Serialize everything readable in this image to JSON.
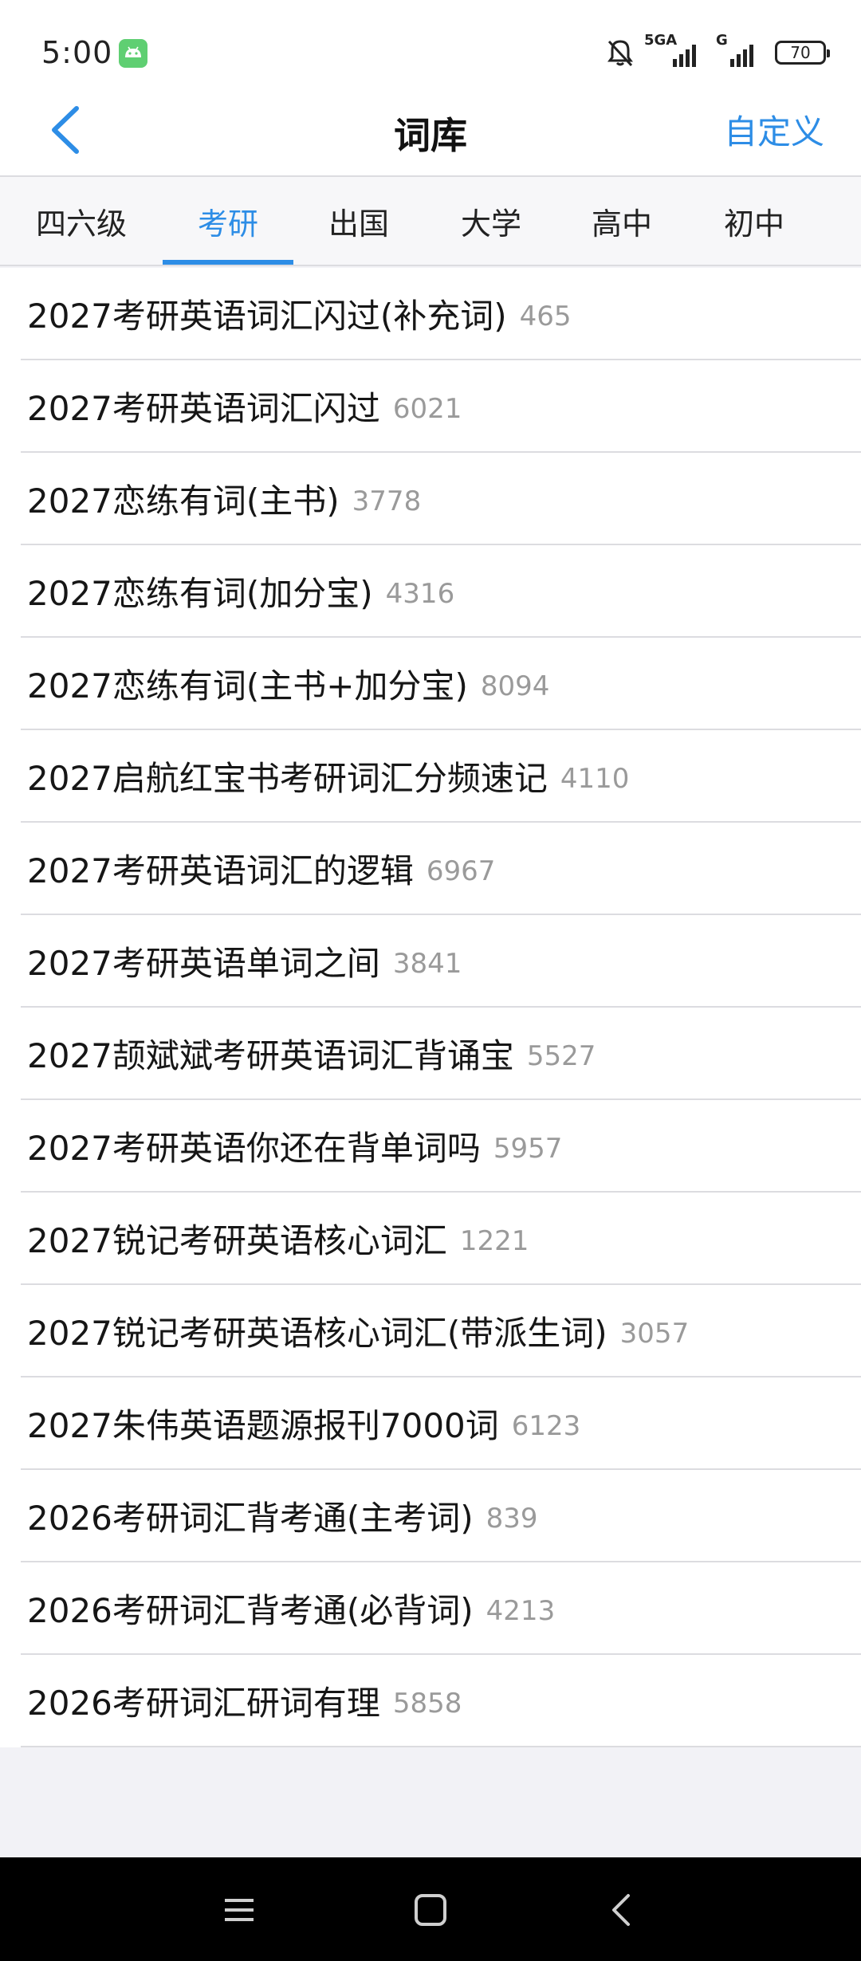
{
  "status_bar": {
    "time": "5:00",
    "network_label": "5GA",
    "network_label2": "G",
    "battery": "70"
  },
  "header": {
    "title": "词库",
    "action_label": "自定义"
  },
  "tabs": [
    {
      "label": "四六级",
      "active": false
    },
    {
      "label": "考研",
      "active": true
    },
    {
      "label": "出国",
      "active": false
    },
    {
      "label": "大学",
      "active": false
    },
    {
      "label": "高中",
      "active": false
    },
    {
      "label": "初中",
      "active": false
    }
  ],
  "books": [
    {
      "name": "2027考研英语词汇闪过(补充词)",
      "count": "465"
    },
    {
      "name": "2027考研英语词汇闪过",
      "count": "6021"
    },
    {
      "name": "2027恋练有词(主书)",
      "count": "3778"
    },
    {
      "name": "2027恋练有词(加分宝)",
      "count": "4316"
    },
    {
      "name": "2027恋练有词(主书+加分宝)",
      "count": "8094"
    },
    {
      "name": "2027启航红宝书考研词汇分频速记",
      "count": "4110"
    },
    {
      "name": "2027考研英语词汇的逻辑",
      "count": "6967"
    },
    {
      "name": "2027考研英语单词之间",
      "count": "3841"
    },
    {
      "name": "2027颉斌斌考研英语词汇背诵宝",
      "count": "5527"
    },
    {
      "name": "2027考研英语你还在背单词吗",
      "count": "5957"
    },
    {
      "name": "2027锐记考研英语核心词汇",
      "count": "1221"
    },
    {
      "name": "2027锐记考研英语核心词汇(带派生词)",
      "count": "3057"
    },
    {
      "name": "2027朱伟英语题源报刊7000词",
      "count": "6123"
    },
    {
      "name": "2026考研词汇背考通(主考词)",
      "count": "839"
    },
    {
      "name": "2026考研词汇背考通(必背词)",
      "count": "4213"
    },
    {
      "name": "2026考研词汇研词有理",
      "count": "5858"
    }
  ],
  "colors": {
    "accent": "#2d8de6",
    "count_gray": "#9a9a9a"
  },
  "icons": {
    "back": "chevron-left-icon",
    "home": "square-icon",
    "menu": "menu-icon",
    "nav_back": "back-icon"
  }
}
